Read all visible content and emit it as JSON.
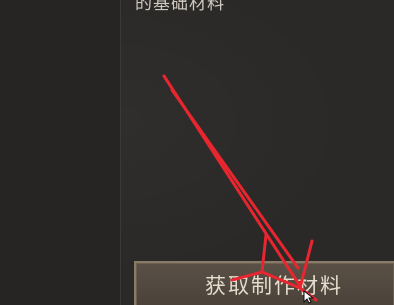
{
  "panel": {
    "description_fragment": "的基础材料"
  },
  "actions": {
    "craft_button_label": "获取制作材料"
  },
  "colors": {
    "background": "#2a2927",
    "button_border": "#8a7b68",
    "button_text": "#e6dccd",
    "annotation_arrow": "#e8262f"
  },
  "icons": {
    "cursor": "mouse-pointer-icon",
    "annotation": "red-arrow-annotation"
  }
}
